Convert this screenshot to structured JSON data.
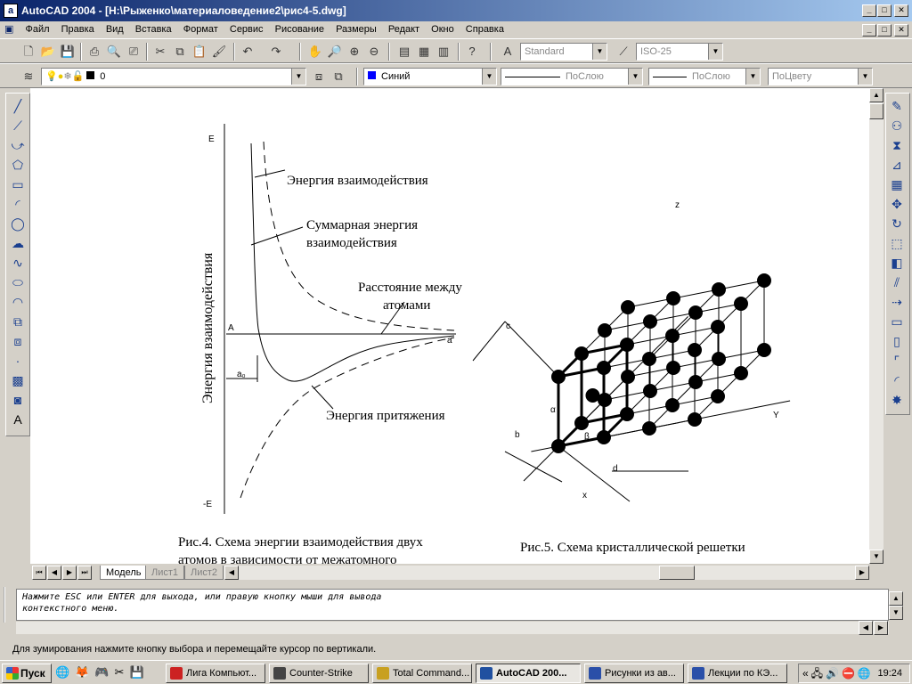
{
  "window": {
    "title": "AutoCAD 2004 - [H:\\Рыженко\\материаловедение2\\рис4-5.dwg]",
    "min": "_",
    "max": "□",
    "close": "✕"
  },
  "menu": [
    "Файл",
    "Правка",
    "Вид",
    "Вставка",
    "Формат",
    "Сервис",
    "Рисование",
    "Размеры",
    "Редакт",
    "Окно",
    "Справка"
  ],
  "toolbar": {
    "text_style": "Standard",
    "dim_style": "ISO-25"
  },
  "layers": {
    "layer": "0",
    "color": "Синий",
    "linetype": "ПоСлою",
    "lineweight": "ПоСлою",
    "plotstyle": "ПоЦвету"
  },
  "drawing": {
    "fig4": {
      "e_top": "E",
      "e_bottom": "-E",
      "y_axis": "Энергия взаимодействия",
      "label_interaction": "Энергия взаимодействия",
      "label_total_1": "Суммарная энергия",
      "label_total_2": "взаимодействия",
      "label_distance_1": "Расстояние между",
      "label_distance_2": "атомами",
      "label_attraction": "Энергия притяжения",
      "point_a": "A",
      "axis_a": "a",
      "a0": "a₀",
      "caption_1": "Рис.4. Схема энергии взаимодействия двух",
      "caption_2": "атомов в зависимости от межатомного"
    },
    "fig5": {
      "axis_z": "z",
      "axis_y": "Y",
      "axis_x": "x",
      "c": "c",
      "b": "b",
      "a": "a",
      "beta": "β",
      "alpha": "α",
      "d": "d",
      "caption": "Рис.5. Схема кристаллической решетки"
    }
  },
  "tabs": [
    "Модель",
    "Лист1",
    "Лист2"
  ],
  "command": {
    "line1": "Нажмите ESC или ENTER для выхода, или правую кнопку мыши для вывода",
    "line2": "контекстного меню."
  },
  "status": "Для зумирования нажмите кнопку выбора и перемещайте курсор по вертикали.",
  "taskbar": {
    "start": "Пуск",
    "tasks": [
      "Лига Компьют...",
      "Counter-Strike",
      "Total Command...",
      "AutoCAD 200...",
      "Рисунки из ав...",
      "Лекции по КЭ..."
    ],
    "clock": "19:24"
  }
}
